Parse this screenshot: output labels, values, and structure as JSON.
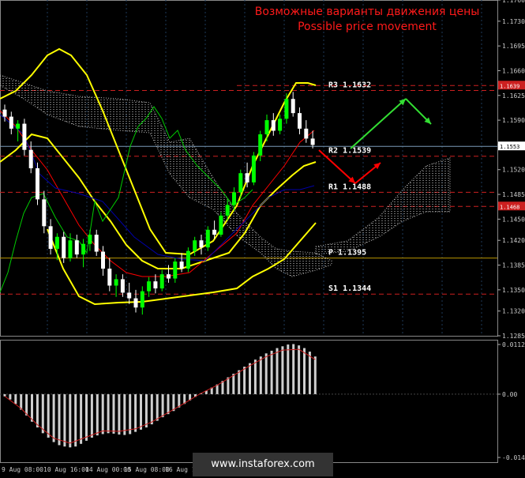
{
  "title": {
    "line1": "Возможные варианты движения цены",
    "line2": "Possible price movement"
  },
  "watermark": "www.instaforex.com",
  "colors": {
    "background": "#000000",
    "grid": "#1e3a5a",
    "bull_candle": "#00ff00",
    "bear_candle": "#ffffff",
    "bollinger": "#ffff00",
    "ichimoku_cloud": "#ffffff",
    "kijun": "#ff0000",
    "tenkan": "#0000aa",
    "chikou": "#00cc00",
    "arrow_up": "#33dd33",
    "arrow_down": "#ff0000",
    "title": "#ff1a1a"
  },
  "price_axis": {
    "ticks": [
      "1.1760",
      "1.1730",
      "1.1695",
      "1.1660",
      "1.1625",
      "1.1590",
      "1.1555",
      "1.1520",
      "1.1485",
      "1.1450",
      "1.1420",
      "1.1385",
      "1.1350",
      "1.1320",
      "1.1285"
    ],
    "current_price": "1.1553",
    "badge_upper": "1.1639",
    "badge_lower": "1.1468"
  },
  "indicator_axis": {
    "ticks": [
      "0.01121",
      "0.00",
      "-0.01427"
    ]
  },
  "time_axis": {
    "labels": [
      "9 Aug 08:00",
      "10 Aug 16:00",
      "14 Aug 00:00",
      "15 Aug 08:00",
      "16 Aug 16:00"
    ]
  },
  "pivots": [
    {
      "name": "R3",
      "label": "R3  1.1632",
      "value": 1.1632
    },
    {
      "name": "R2",
      "label": "R2  1.1539",
      "value": 1.1539
    },
    {
      "name": "R1",
      "label": "R1  1.1488",
      "value": 1.1488
    },
    {
      "name": "P",
      "label": "P  1.1395",
      "value": 1.1395
    },
    {
      "name": "S1",
      "label": "S1  1.1344",
      "value": 1.1344
    }
  ],
  "chart_data": {
    "type": "candlestick",
    "y_range": [
      1.1285,
      1.176
    ],
    "candles": [
      [
        1.1605,
        1.1612,
        1.1588,
        1.1595
      ],
      [
        1.1595,
        1.1602,
        1.157,
        1.1578
      ],
      [
        1.1578,
        1.159,
        1.156,
        1.1585
      ],
      [
        1.1585,
        1.1592,
        1.154,
        1.1548
      ],
      [
        1.1548,
        1.156,
        1.1515,
        1.1522
      ],
      [
        1.1522,
        1.153,
        1.147,
        1.1478
      ],
      [
        1.1478,
        1.149,
        1.143,
        1.144
      ],
      [
        1.144,
        1.145,
        1.14,
        1.1408
      ],
      [
        1.1408,
        1.143,
        1.1392,
        1.1425
      ],
      [
        1.1425,
        1.1432,
        1.1388,
        1.1395
      ],
      [
        1.1395,
        1.143,
        1.139,
        1.142
      ],
      [
        1.142,
        1.1428,
        1.1395,
        1.14
      ],
      [
        1.14,
        1.1422,
        1.1382,
        1.1415
      ],
      [
        1.1415,
        1.1435,
        1.1405,
        1.1428
      ],
      [
        1.1428,
        1.1435,
        1.1398,
        1.1404
      ],
      [
        1.1404,
        1.1412,
        1.137,
        1.138
      ],
      [
        1.138,
        1.1395,
        1.1348,
        1.1356
      ],
      [
        1.1356,
        1.1372,
        1.134,
        1.1365
      ],
      [
        1.1365,
        1.1372,
        1.134,
        1.1346
      ],
      [
        1.1346,
        1.136,
        1.133,
        1.1338
      ],
      [
        1.1338,
        1.135,
        1.1318,
        1.1325
      ],
      [
        1.1325,
        1.1355,
        1.1315,
        1.1348
      ],
      [
        1.1348,
        1.1368,
        1.134,
        1.1362
      ],
      [
        1.1362,
        1.1372,
        1.1345,
        1.1352
      ],
      [
        1.1352,
        1.1378,
        1.1348,
        1.1372
      ],
      [
        1.1372,
        1.1385,
        1.136,
        1.1366
      ],
      [
        1.1366,
        1.1395,
        1.136,
        1.139
      ],
      [
        1.139,
        1.1402,
        1.1375,
        1.138
      ],
      [
        1.138,
        1.141,
        1.1375,
        1.1405
      ],
      [
        1.1405,
        1.1425,
        1.1398,
        1.142
      ],
      [
        1.142,
        1.1428,
        1.14,
        1.141
      ],
      [
        1.141,
        1.144,
        1.1405,
        1.1435
      ],
      [
        1.1435,
        1.1448,
        1.1422,
        1.1428
      ],
      [
        1.1428,
        1.146,
        1.1425,
        1.1455
      ],
      [
        1.1455,
        1.1478,
        1.1448,
        1.147
      ],
      [
        1.147,
        1.1495,
        1.1462,
        1.1488
      ],
      [
        1.1488,
        1.152,
        1.148,
        1.1515
      ],
      [
        1.1515,
        1.153,
        1.1495,
        1.1502
      ],
      [
        1.1502,
        1.1545,
        1.1498,
        1.154
      ],
      [
        1.154,
        1.1575,
        1.1532,
        1.157
      ],
      [
        1.157,
        1.1598,
        1.156,
        1.159
      ],
      [
        1.159,
        1.16,
        1.1568,
        1.1575
      ],
      [
        1.1575,
        1.1598,
        1.157,
        1.1592
      ],
      [
        1.1592,
        1.1628,
        1.1585,
        1.162
      ],
      [
        1.162,
        1.163,
        1.1595,
        1.16
      ],
      [
        1.16,
        1.1608,
        1.157,
        1.1578
      ],
      [
        1.1578,
        1.159,
        1.1558,
        1.1564
      ],
      [
        1.1564,
        1.1575,
        1.155,
        1.1555
      ]
    ],
    "macd_histogram": [
      -0.0005,
      -0.0012,
      -0.0022,
      -0.0035,
      -0.0048,
      -0.0062,
      -0.0075,
      -0.0088,
      -0.0098,
      -0.0108,
      -0.0115,
      -0.0118,
      -0.012,
      -0.0118,
      -0.0112,
      -0.0105,
      -0.0098,
      -0.0093,
      -0.009,
      -0.0088,
      -0.0089,
      -0.0091,
      -0.0092,
      -0.009,
      -0.0085,
      -0.008,
      -0.0075,
      -0.0068,
      -0.006,
      -0.0052,
      -0.0045,
      -0.0038,
      -0.003,
      -0.0022,
      -0.0014,
      -0.0006,
      0.0002,
      0.0008,
      0.0015,
      0.0022,
      0.003,
      0.0038,
      0.0046,
      0.0054,
      0.0062,
      0.007,
      0.0078,
      0.0085,
      0.0092,
      0.0098,
      0.0104,
      0.0108,
      0.0112,
      0.0113,
      0.011,
      0.0104,
      0.0096,
      0.0085
    ]
  }
}
